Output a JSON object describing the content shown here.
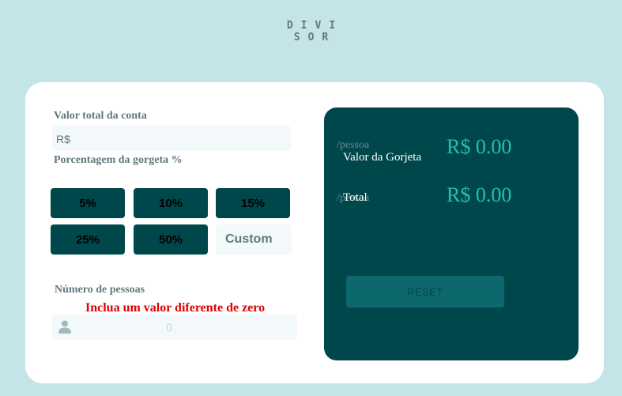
{
  "logo": {
    "line1": "DIVI",
    "line2": "SOR"
  },
  "bill": {
    "label": "Valor total da conta",
    "value": "R$"
  },
  "tip": {
    "label": "Porcentagem da gorgeta %",
    "options": [
      "5%",
      "10%",
      "15%",
      "25%",
      "50%"
    ],
    "custom_placeholder": "Custom"
  },
  "people": {
    "label": "Número de pessoas",
    "error": "Inclua um valor diferente de zero",
    "value": "0",
    "icon": "person-icon"
  },
  "results": {
    "tip_per_person_suffix": "/pessoa",
    "tip_label": "Valor da Gorjeta",
    "tip_amount": "R$ 0.00",
    "total_per_person_suffix": "/pessoa",
    "total_label": "Total",
    "total_amount": "R$ 0.00",
    "reset_label": "RESET"
  },
  "colors": {
    "background": "#c5e4e7",
    "dark_cyan": "#00474b",
    "strong_cyan": "#26c0ab",
    "error": "#e00000"
  }
}
